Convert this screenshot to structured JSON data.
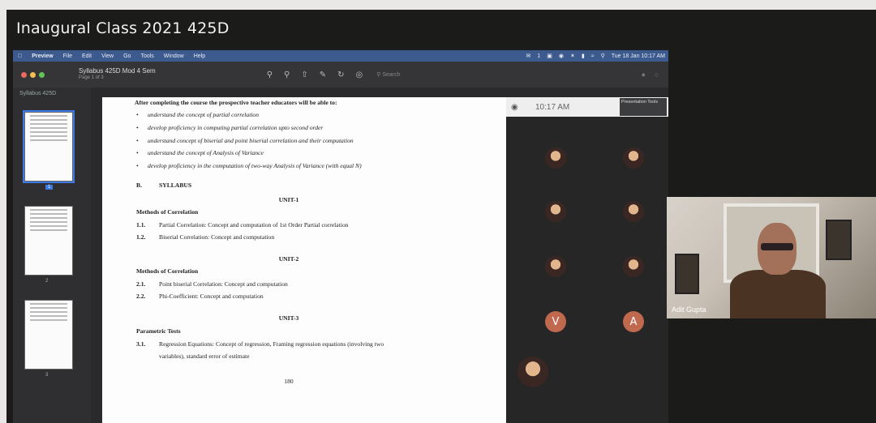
{
  "meeting": {
    "title": "Inaugural Class 2021 425D"
  },
  "menubar": {
    "items": [
      "Preview",
      "File",
      "Edit",
      "View",
      "Go",
      "Tools",
      "Window",
      "Help"
    ],
    "right_count": "1",
    "datetime": "Tue 18 Jan  10:17 AM"
  },
  "preview": {
    "doc_title": "Syllabus 425D Mod 4 Sem",
    "page_info": "Page 1 of 3",
    "search_placeholder": "Search",
    "sidebar_title": "Syllabus 425D",
    "thumb_labels": [
      "1",
      "2",
      "3"
    ]
  },
  "document": {
    "intro": "After completing the course the prospective teacher educators will be able to:",
    "objectives": [
      "understand the concept of partial correlation",
      "develop proficiency in computing partial correlation upto second order",
      "understand concept of biserial and point biserial correlation and their computation",
      "understand the concept of Analysis of Variance",
      "develop proficiency in the computation of two-way Analysis of Variance (with equal N)"
    ],
    "section_letter": "B.",
    "section_title": "SYLLABUS",
    "unit1": "UNIT-1",
    "unit1_heading": "Methods of Correlation",
    "u1_n1": "1.1.",
    "u1_t1": "Partial Correlation: Concept and computation of 1st Order Partial correlation",
    "u1_n2": "1.2.",
    "u1_t2": "Biserial Correlation: Concept and computation",
    "unit2": "UNIT-2",
    "unit2_heading": "Methods of Correlation",
    "u2_n1": "2.1.",
    "u2_t1": "Point biserial Correlation: Concept and computation",
    "u2_n2": "2.2.",
    "u2_t2": "Phi-Coefficient: Concept and computation",
    "unit3": "UNIT-3",
    "unit3_heading": "Parametric Tests",
    "u3_n1": "3.1.",
    "u3_t1a": "Regression Equations: Concept of regression, Framing regression equations (involving two",
    "u3_t1b": "variables), standard error of estimate",
    "page_number": "180"
  },
  "zoom": {
    "time": "10:17 AM",
    "presentation_label": "Presentation Tools",
    "participants": [
      {
        "type": "photo"
      },
      {
        "type": "photo"
      },
      {
        "type": "photo"
      },
      {
        "type": "photo"
      },
      {
        "type": "photo"
      },
      {
        "type": "photo"
      },
      {
        "type": "initial",
        "initial": "V"
      },
      {
        "type": "initial",
        "initial": "A"
      },
      {
        "type": "photo"
      }
    ],
    "speaker_name": "Adit Gupta"
  },
  "colors": {
    "menubar": "#3c5a8e",
    "avatar_initial": "#c1694f",
    "selection": "#3d7ae6"
  }
}
